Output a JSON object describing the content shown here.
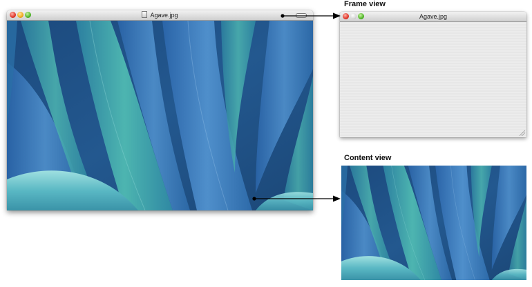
{
  "main_window": {
    "title": "Agave.jpg"
  },
  "frame_view": {
    "label": "Frame view",
    "title": "Agave.jpg"
  },
  "content_view": {
    "label": "Content view"
  },
  "image_description_colors": {
    "dark_blue": "#1f4f86",
    "mid_blue": "#3f7fb6",
    "teal": "#3aa6a4",
    "light_cyan": "#8fd6d6"
  },
  "icons": [
    "close-icon",
    "minimize-icon",
    "zoom-icon",
    "document-proxy-icon",
    "toolbar-toggle-icon",
    "resize-grip-icon"
  ]
}
